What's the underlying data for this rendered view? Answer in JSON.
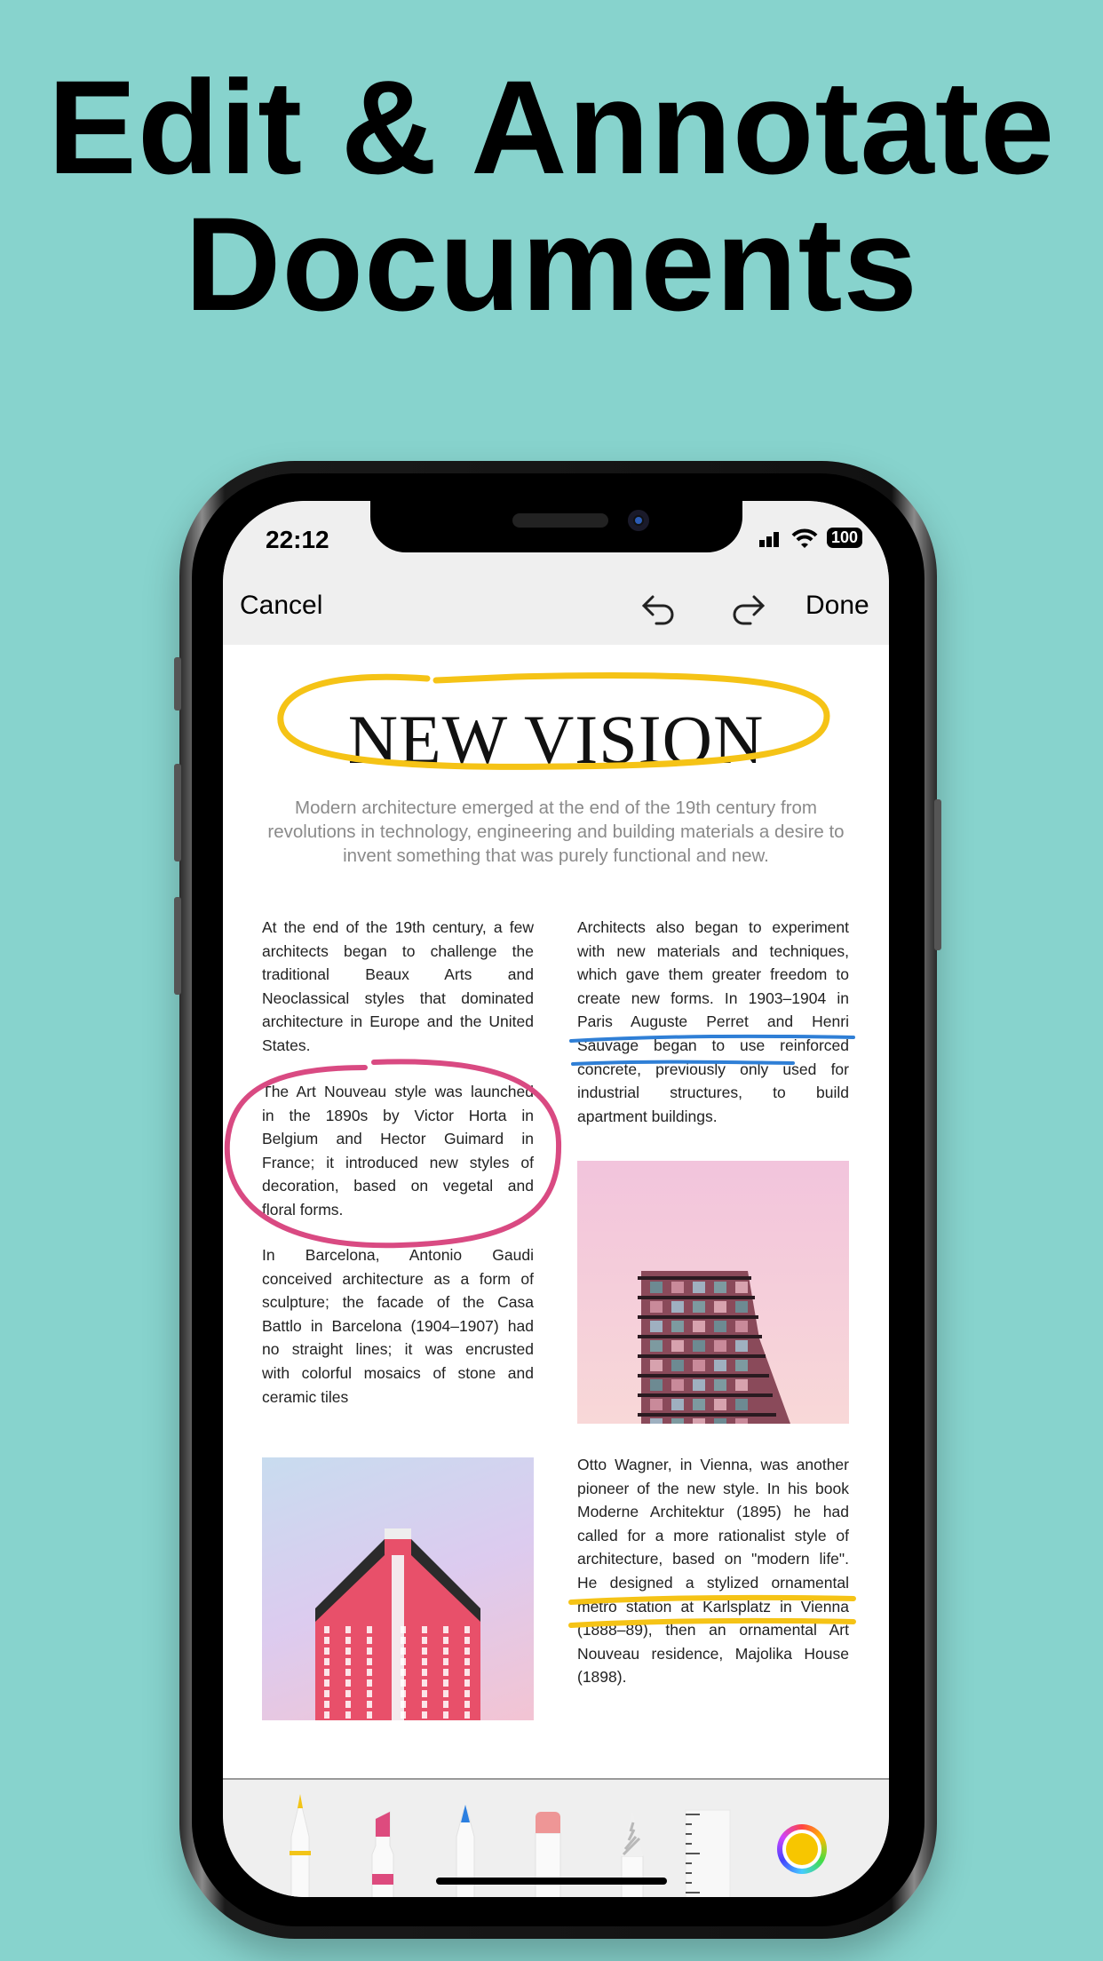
{
  "headline": {
    "line1": "Edit & Annotate",
    "line2": "Documents"
  },
  "status": {
    "time": "22:12",
    "battery": "100"
  },
  "nav": {
    "cancel": "Cancel",
    "done": "Done",
    "undo_icon": "undo-arrow",
    "redo_icon": "redo-arrow"
  },
  "document": {
    "title": "NEW VISION",
    "subtitle": [
      "Modern architecture emerged at the end of the 19th century from",
      "revolutions in technology, engineering and building materials a desire to",
      "invent something that was purely functional and new."
    ],
    "left_col": {
      "p1": [
        "At the end of the 19th century, a few",
        "architects began to challenge the",
        "traditional Beaux Arts and",
        "Neoclassical styles that dominated",
        "architecture in Europe and the United",
        "States."
      ],
      "p2": [
        "The Art Nouveau style was launched",
        "in the 1890s by Victor Horta in",
        "Belgium and Hector Guimard in",
        "France; it introduced new styles of",
        "decoration, based on vegetal and",
        "floral forms."
      ],
      "p3": [
        "In Barcelona, Antonio Gaudi",
        "conceived architecture as a form of",
        "sculpture; the facade of the Casa",
        "Battlo in Barcelona (1904–1907) had",
        "no straight lines; it was encrusted",
        "with colorful mosaics of stone and",
        "ceramic tiles"
      ]
    },
    "right_col": {
      "p1": [
        "Architects also began to experiment",
        "with new materials and techniques,",
        "which gave them greater freedom to",
        "create new forms. In 1903–1904 in",
        "Paris Auguste Perret and Henri",
        "Sauvage began to use reinforced",
        "concrete, previously only used for",
        "industrial structures, to build",
        "apartment buildings."
      ],
      "p2": [
        "Otto Wagner, in Vienna, was another",
        "pioneer of the new style. In his book",
        "Moderne Architektur (1895) he had",
        "called for a more rationalist style of",
        "architecture, based on \"modern life\".",
        "He designed a stylized ornamental",
        "metro station at Karlsplatz in Vienna",
        "(1888–89), then an ornamental Art",
        "Nouveau residence, Majolika House",
        "(1898)."
      ]
    }
  },
  "annotations": {
    "title_circle_color": "#f5c316",
    "paragraph_circle_color": "#d94a82",
    "underline_blue": "#2f7fd6",
    "underline_yellow": "#f5c316"
  },
  "toolbar": {
    "tools": [
      {
        "name": "pen",
        "color": "#f2c418"
      },
      {
        "name": "marker",
        "color": "#dd4b7e"
      },
      {
        "name": "pencil",
        "color": "#2b7fe0"
      },
      {
        "name": "eraser",
        "color": "#ee9696"
      },
      {
        "name": "lasso",
        "color": "#bbbbbb"
      },
      {
        "name": "ruler",
        "color": "#f6f6f6"
      }
    ],
    "selected_color": "#f7c600"
  }
}
